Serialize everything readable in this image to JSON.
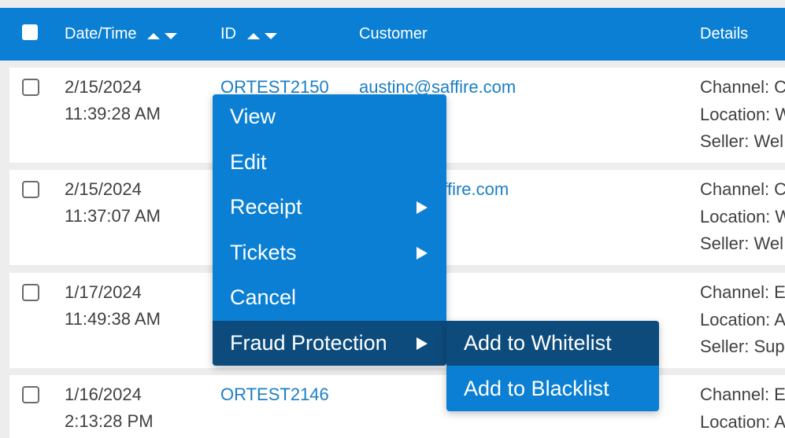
{
  "header": {
    "columns": {
      "datetime": "Date/Time",
      "id": "ID",
      "customer": "Customer",
      "details": "Details"
    }
  },
  "rows": [
    {
      "date": "2/15/2024",
      "time": "11:39:28 AM",
      "id": "ORTEST2150",
      "customer": "austinc@saffire.com",
      "details": [
        "Channel: C",
        "Location: W",
        "Seller: Wel"
      ]
    },
    {
      "date": "2/15/2024",
      "time": "11:37:07 AM",
      "id": "",
      "customer": "affire.com",
      "details": [
        "Channel: C",
        "Location: W",
        "Seller: Wel"
      ]
    },
    {
      "date": "1/17/2024",
      "time": "11:49:38 AM",
      "id": "",
      "customer": "",
      "details": [
        "Channel: E",
        "Location: A",
        "Seller: Sup"
      ]
    },
    {
      "date": "1/16/2024",
      "time": "2:13:28 PM",
      "id": "ORTEST2146",
      "customer": "",
      "details": [
        "Channel: E",
        "Location: A"
      ]
    }
  ],
  "context_menu": {
    "items": [
      "View",
      "Edit",
      "Receipt",
      "Tickets",
      "Cancel",
      "Fraud Protection"
    ],
    "submenu": [
      "Add to Whitelist",
      "Add to Blacklist"
    ]
  },
  "colors": {
    "header_bg": "#0a7fd3",
    "menu_bg": "#0a7fd3",
    "menu_active": "#0c4b7c",
    "link": "#1b7fc4"
  }
}
